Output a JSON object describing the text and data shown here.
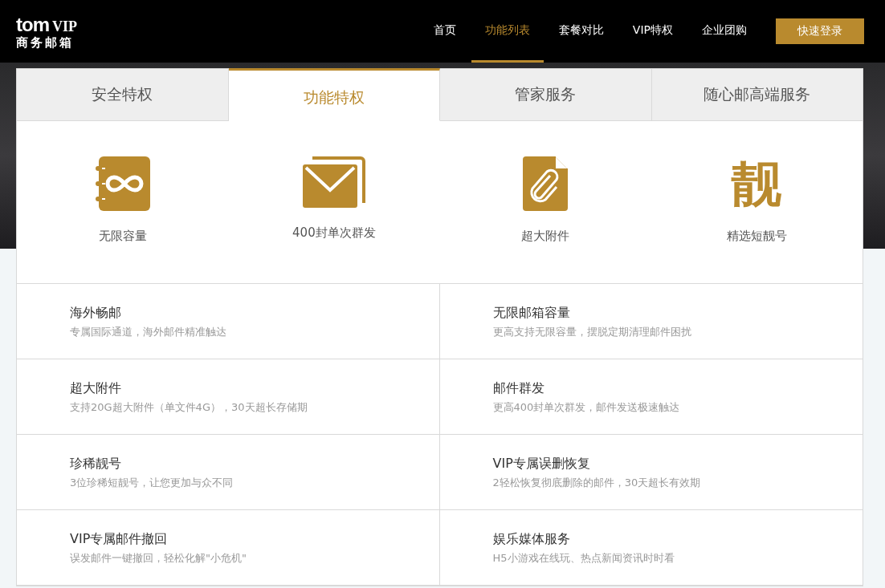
{
  "header": {
    "logo": {
      "brand": "tom",
      "tier": "VIP",
      "subtitle": "商务邮箱"
    },
    "nav": [
      {
        "label": "首页",
        "selected": false
      },
      {
        "label": "功能列表",
        "selected": true
      },
      {
        "label": "套餐对比",
        "selected": false
      },
      {
        "label": "VIP特权",
        "selected": false
      },
      {
        "label": "企业团购",
        "selected": false
      }
    ],
    "login_button": "快速登录"
  },
  "tabs": [
    {
      "label": "安全特权",
      "selected": false
    },
    {
      "label": "功能特权",
      "selected": true
    },
    {
      "label": "管家服务",
      "selected": false
    },
    {
      "label": "随心邮高端服务",
      "selected": false
    }
  ],
  "highlights": [
    {
      "kind": "infinity",
      "label": "无限容量"
    },
    {
      "kind": "mail",
      "label": "400封单次群发"
    },
    {
      "kind": "attachment",
      "label": "超大附件"
    },
    {
      "kind": "glyph",
      "glyph": "靓",
      "label": "精选短靓号"
    }
  ],
  "features": [
    {
      "title": "海外畅邮",
      "description": "专属国际通道，海外邮件精准触达"
    },
    {
      "title": "无限邮箱容量",
      "description": "更高支持无限容量，摆脱定期清理邮件困扰"
    },
    {
      "title": "超大附件",
      "description": "支持20G超大附件（单文件4G），30天超长存储期"
    },
    {
      "title": "邮件群发",
      "description": "更高400封单次群发，邮件发送极速触达"
    },
    {
      "title": "珍稀靓号",
      "description": "3位珍稀短靓号，让您更加与众不同"
    },
    {
      "title": "VIP专属误删恢复",
      "description": "2轻松恢复彻底删除的邮件，30天超长有效期"
    },
    {
      "title": "VIP专属邮件撤回",
      "description": "误发邮件一键撤回，轻松化解\"小危机\""
    },
    {
      "title": "娱乐媒体服务",
      "description": "H5小游戏在线玩、热点新闻资讯时时看"
    }
  ]
}
